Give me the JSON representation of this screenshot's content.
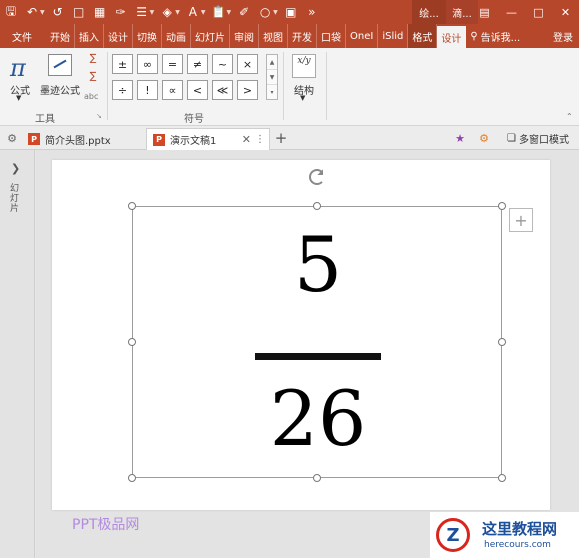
{
  "titlebar": {
    "qat_icons": [
      "save-icon",
      "undo-icon",
      "redo-icon",
      "new-doc-icon",
      "table-icon",
      "eyedropper-icon",
      "align-icon",
      "fill-icon",
      "font-color-icon",
      "paste-icon",
      "format-painter-icon",
      "shape-icon",
      "more-icon"
    ],
    "ctx_title_1": "绘...",
    "ctx_title_2": "滴...",
    "brand_color": "#b7472a"
  },
  "ribbon_tabs": [
    "文件",
    "开始",
    "插入",
    "设计",
    "切换",
    "动画",
    "幻灯片",
    "审阅",
    "视图",
    "开发",
    "口袋",
    "OneI",
    "iSlid",
    "格式",
    "设计",
    "告诉我...",
    "登录"
  ],
  "ribbon": {
    "tools_group": {
      "formula_label": "公式",
      "ink_formula_label": "墨迹公式",
      "abc_label": "abc",
      "group_label": "工具"
    },
    "symbols_group": {
      "symbols": [
        "±",
        "∞",
        "=",
        "≠",
        "~",
        "×",
        "÷",
        "!",
        "∝",
        "<",
        "≪",
        ">"
      ],
      "group_label": "符号"
    },
    "structures_group": {
      "icon_text": "x/y",
      "label": "结构"
    }
  },
  "doc_tabs": {
    "tab1": "简介头图.pptx",
    "tab2": "演示文稿1",
    "multi_window": "多窗口模式"
  },
  "left_pane": {
    "vertical_text": "幻灯片"
  },
  "equation": {
    "numerator": "5",
    "denominator": "26"
  },
  "watermark": "PPT极品网",
  "logo": {
    "letter": "Z",
    "name": "这里教程网",
    "url": "herecours.com"
  }
}
